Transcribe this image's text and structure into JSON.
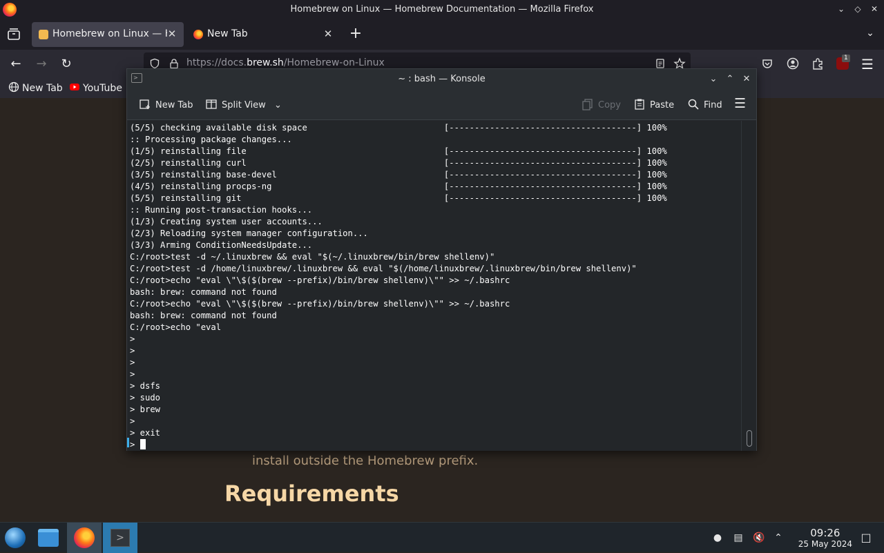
{
  "firefox": {
    "window_title": "Homebrew on Linux — Homebrew Documentation — Mozilla Firefox",
    "tabs": [
      {
        "label": "Homebrew on Linux — H",
        "active": true
      },
      {
        "label": "New Tab",
        "active": false
      }
    ],
    "url_prefix": "https://docs.",
    "url_domain": "brew.sh",
    "url_path": "/Homebrew-on-Linux",
    "bookmarks": [
      {
        "label": "New Tab",
        "icon": "globe-icon"
      },
      {
        "label": "YouTube",
        "icon": "youtube-icon"
      }
    ],
    "extension_badge": "1"
  },
  "page": {
    "text_line": "install outside the Homebrew prefix.",
    "heading": "Requirements"
  },
  "konsole": {
    "title": "~ : bash — Konsole",
    "toolbar": {
      "new_tab": "New Tab",
      "split_view": "Split View",
      "copy": "Copy",
      "paste": "Paste",
      "find": "Find"
    },
    "terminal_lines": [
      "(5/5) checking available disk space                           [-------------------------------------] 100%",
      ":: Processing package changes...",
      "(1/5) reinstalling file                                       [-------------------------------------] 100%",
      "(2/5) reinstalling curl                                       [-------------------------------------] 100%",
      "(3/5) reinstalling base-devel                                 [-------------------------------------] 100%",
      "(4/5) reinstalling procps-ng                                  [-------------------------------------] 100%",
      "(5/5) reinstalling git                                        [-------------------------------------] 100%",
      ":: Running post-transaction hooks...",
      "(1/3) Creating system user accounts...",
      "(2/3) Reloading system manager configuration...",
      "(3/3) Arming ConditionNeedsUpdate...",
      "C:/root>test -d ~/.linuxbrew && eval \"$(~/.linuxbrew/bin/brew shellenv)\"",
      "C:/root>test -d /home/linuxbrew/.linuxbrew && eval \"$(/home/linuxbrew/.linuxbrew/bin/brew shellenv)\"",
      "C:/root>echo \"eval \\\"\\$($(brew --prefix)/bin/brew shellenv)\\\"\" >> ~/.bashrc",
      "bash: brew: command not found",
      "C:/root>echo \"eval \\\"\\$($(brew --prefix)/bin/brew shellenv)\\\"\" >> ~/.bashrc",
      "bash: brew: command not found",
      "C:/root>echo \"eval",
      ">",
      ">",
      ">",
      ">",
      "> dsfs",
      "> sudo",
      "> brew",
      ">",
      "> exit",
      "> "
    ]
  },
  "taskbar": {
    "time": "09:26",
    "date": "25 May 2024"
  }
}
